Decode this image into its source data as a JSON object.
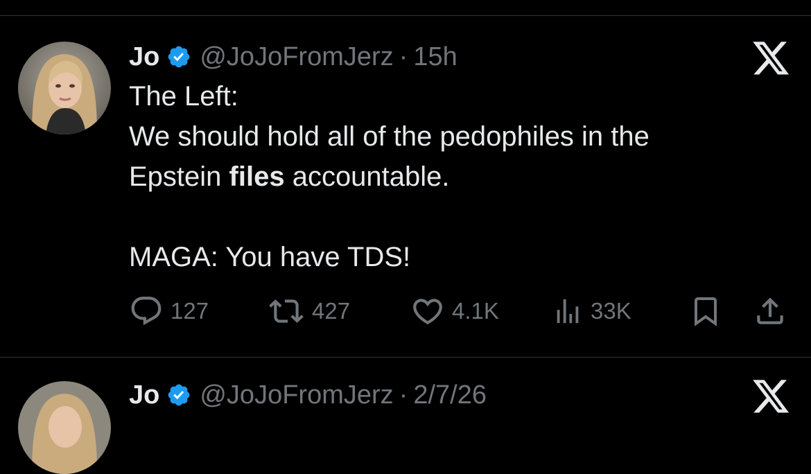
{
  "tweet1": {
    "author_name": "Jo",
    "handle": "@JoJoFromJerz",
    "separator": "·",
    "time": "15h",
    "verified": true,
    "lines": [
      {
        "text": "The Left:"
      },
      {
        "text": "We should hold all of the pedophiles in the"
      },
      {
        "pre": "Epstein ",
        "bold": "files",
        "post": " accountable."
      },
      {
        "text": ""
      },
      {
        "text": "MAGA: You have TDS!"
      }
    ],
    "actions": {
      "replies": "127",
      "reposts": "427",
      "likes": "4.1K",
      "views": "33K"
    }
  },
  "tweet2": {
    "author_name": "Jo",
    "handle": "@JoJoFromJerz",
    "separator": "·",
    "time": "2/7/26"
  },
  "colors": {
    "background": "#000000",
    "text_primary": "#e7e9ea",
    "text_secondary": "#71767b",
    "verified_blue": "#1d9bf0",
    "divider": "#2f3336"
  },
  "icons": [
    "verified-badge-icon",
    "x-logo-icon",
    "reply-icon",
    "repost-icon",
    "like-icon",
    "views-icon",
    "bookmark-icon",
    "share-icon"
  ]
}
